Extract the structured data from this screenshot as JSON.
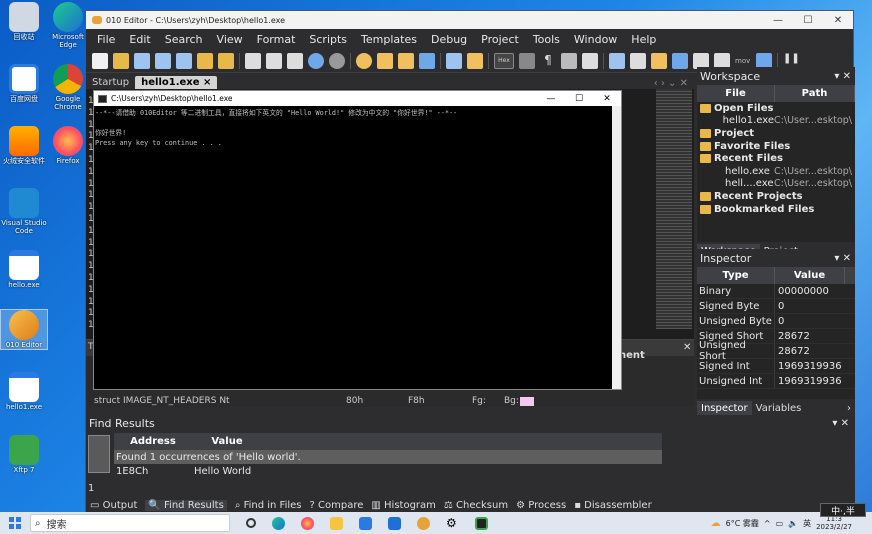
{
  "desktop_icons": [
    {
      "label": "回收站"
    },
    {
      "label": "Microsoft Edge"
    },
    {
      "label": "百度网盘"
    },
    {
      "label": "Google Chrome"
    },
    {
      "label": "火绒安全软件"
    },
    {
      "label": "Firefox"
    },
    {
      "label": "Visual Studio Code"
    },
    {
      "label": "hello.exe"
    },
    {
      "label": "010 Editor"
    },
    {
      "label": "hello1.exe"
    },
    {
      "label": "Xftp 7"
    }
  ],
  "window": {
    "title": "010 Editor - C:\\Users\\zyh\\Desktop\\hello1.exe"
  },
  "menu": [
    "File",
    "Edit",
    "Search",
    "View",
    "Format",
    "Scripts",
    "Templates",
    "Debug",
    "Project",
    "Tools",
    "Window",
    "Help"
  ],
  "toolbar": {
    "hex_label": "Hex",
    "mov_label": "mov"
  },
  "tabs": {
    "startup": "Startup",
    "active": "hello1.exe",
    "close": "×"
  },
  "gutter": [
    "1",
    "1",
    "1",
    "1",
    "1",
    "1",
    "1",
    "1",
    "1",
    "1",
    "1",
    "1",
    "1",
    "1",
    "1",
    "1",
    "1",
    "1",
    "1",
    "1"
  ],
  "template": {
    "header": "nent",
    "row1": "struct IMAGE_NT_HEADERS Nt",
    "row1_start": "80h",
    "row1_size": "F8h",
    "row1_col": "Fg:",
    "row1_bg": "Bg:",
    "letter": "T"
  },
  "workspace": {
    "title": "Workspace",
    "col_file": "File",
    "col_path": "Path",
    "rows": [
      {
        "name": "Open Files",
        "path": "",
        "bold": true,
        "indent": false
      },
      {
        "name": "hello1.exe",
        "path": "C:\\User...esktop\\",
        "bold": false,
        "indent": true
      },
      {
        "name": "Project",
        "path": "",
        "bold": true,
        "indent": false
      },
      {
        "name": "Favorite Files",
        "path": "",
        "bold": true,
        "indent": false
      },
      {
        "name": "Recent Files",
        "path": "",
        "bold": true,
        "indent": false
      },
      {
        "name": "hello.exe",
        "path": "C:\\User...esktop\\",
        "bold": false,
        "indent": true
      },
      {
        "name": "hell....exe",
        "path": "C:\\User...esktop\\",
        "bold": false,
        "indent": true
      },
      {
        "name": "Recent Projects",
        "path": "",
        "bold": true,
        "indent": false
      },
      {
        "name": "Bookmarked Files",
        "path": "",
        "bold": true,
        "indent": false
      }
    ],
    "tab_workspace": "Workspace",
    "tab_project": "Project"
  },
  "inspector": {
    "title": "Inspector",
    "col_type": "Type",
    "col_value": "Value",
    "rows": [
      {
        "type": "Binary",
        "value": "00000000"
      },
      {
        "type": "Signed Byte",
        "value": "0"
      },
      {
        "type": "Unsigned Byte",
        "value": "0"
      },
      {
        "type": "Signed Short",
        "value": "28672"
      },
      {
        "type": "Unsigned Short",
        "value": "28672"
      },
      {
        "type": "Signed Int",
        "value": "1969319936"
      },
      {
        "type": "Unsigned Int",
        "value": "1969319936"
      }
    ],
    "tab_inspector": "Inspector",
    "tab_variables": "Variables"
  },
  "find": {
    "title": "Find Results",
    "col_address": "Address",
    "col_value": "Value",
    "summary": "Found 1 occurrences of 'Hello world'.",
    "address": "1E8Ch",
    "value": "Hello World",
    "count": "1"
  },
  "bottom_tabs": [
    "Output",
    "Find Results",
    "Find in Files",
    "Compare",
    "Histogram",
    "Checksum",
    "Process",
    "Disassembler"
  ],
  "console": {
    "title": "C:\\Users\\zyh\\Desktop\\hello1.exe",
    "line1": "--*--请借助 010Editor 等二进制工具，直接将如下英文的 \"Hello World!\" 修改为中文的 \"你好世界!\" --*--",
    "line2": "",
    "line3": "你好世界!",
    "line4": "Press any key to continue . . ."
  },
  "taskbar": {
    "search": "搜索",
    "weather": "6°C 雾霾",
    "ime": "英",
    "time": "11:3",
    "date": "2023/2/27",
    "ime_bar": "中·,半"
  }
}
